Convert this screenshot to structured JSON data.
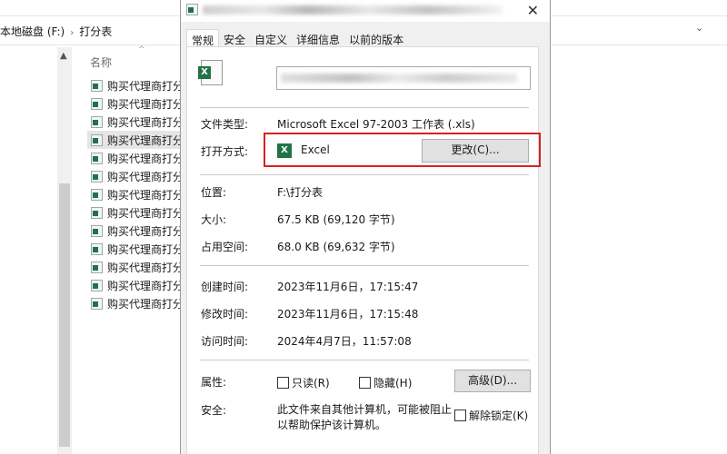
{
  "explorer": {
    "breadcrumb": [
      "本地磁盘 (F:)",
      "打分表"
    ],
    "column_header": "名称",
    "files": [
      "购买代理商打分",
      "购买代理商打分",
      "购买代理商打分",
      "购买代理商打分",
      "购买代理商打分",
      "购买代理商打分",
      "购买代理商打分",
      "购买代理商打分",
      "购买代理商打分",
      "购买代理商打分",
      "购买代理商打分",
      "购买代理商打分",
      "购买代理商打分"
    ],
    "selected_index": 3
  },
  "dialog": {
    "close": "✕",
    "tabs": [
      "常规",
      "安全",
      "自定义",
      "详细信息",
      "以前的版本"
    ],
    "file_type_label": "文件类型:",
    "file_type": "Microsoft Excel 97-2003 工作表 (.xls)",
    "open_with_label": "打开方式:",
    "open_with": "Excel",
    "change_button": "更改(C)...",
    "location_label": "位置:",
    "location": "F:\\打分表",
    "size_label": "大小:",
    "size": "67.5 KB (69,120 字节)",
    "disk_size_label": "占用空间:",
    "disk_size": "68.0 KB (69,632 字节)",
    "created_label": "创建时间:",
    "created": "2023年11月6日，17:15:47",
    "modified_label": "修改时间:",
    "modified": "2023年11月6日，17:15:48",
    "accessed_label": "访问时间:",
    "accessed": "2024年4月7日，11:57:08",
    "attributes_label": "属性:",
    "readonly": "只读(R)",
    "hidden": "隐藏(H)",
    "advanced_button": "高级(D)...",
    "security_label": "安全:",
    "security_text_1": "此文件来自其他计算机，可能被阻止",
    "security_text_2": "以帮助保护该计算机。",
    "unblock": "解除锁定(K)"
  }
}
